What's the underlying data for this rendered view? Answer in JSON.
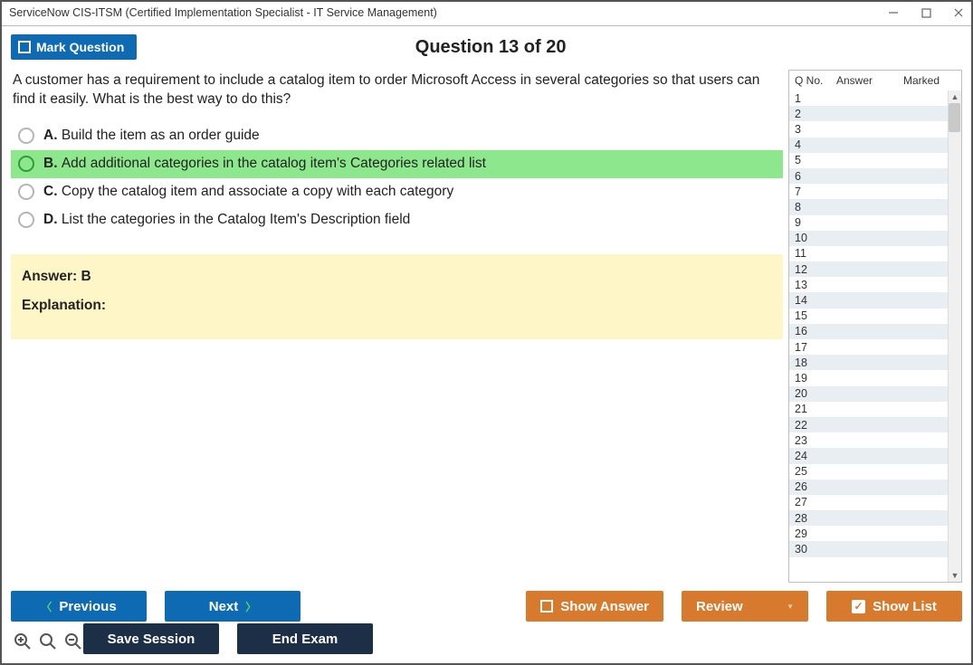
{
  "window": {
    "title": "ServiceNow CIS-ITSM (Certified Implementation Specialist - IT Service Management)"
  },
  "header": {
    "mark_label": "Mark Question",
    "question_title": "Question 13 of 20"
  },
  "question": {
    "text": "A customer has a requirement to include a catalog item to order Microsoft Access in several categories so that users can find it easily. What is the best way to do this?",
    "options": [
      {
        "letter": "A.",
        "text": "Build the item as an order guide",
        "correct": false
      },
      {
        "letter": "B.",
        "text": "Add additional categories in the catalog item's Categories related list",
        "correct": true
      },
      {
        "letter": "C.",
        "text": "Copy the catalog item and associate a copy with each category",
        "correct": false
      },
      {
        "letter": "D.",
        "text": "List the categories in the Catalog Item's Description field",
        "correct": false
      }
    ],
    "answer_label": "Answer: B",
    "explanation_label": "Explanation:"
  },
  "sidebar": {
    "cols": {
      "qno": "Q No.",
      "answer": "Answer",
      "marked": "Marked"
    },
    "rows": [
      "1",
      "2",
      "3",
      "4",
      "5",
      "6",
      "7",
      "8",
      "9",
      "10",
      "11",
      "12",
      "13",
      "14",
      "15",
      "16",
      "17",
      "18",
      "19",
      "20",
      "21",
      "22",
      "23",
      "24",
      "25",
      "26",
      "27",
      "28",
      "29",
      "30"
    ]
  },
  "footer": {
    "previous": "Previous",
    "next": "Next",
    "show_answer": "Show Answer",
    "review": "Review",
    "show_list": "Show List",
    "save_session": "Save Session",
    "end_exam": "End Exam"
  }
}
